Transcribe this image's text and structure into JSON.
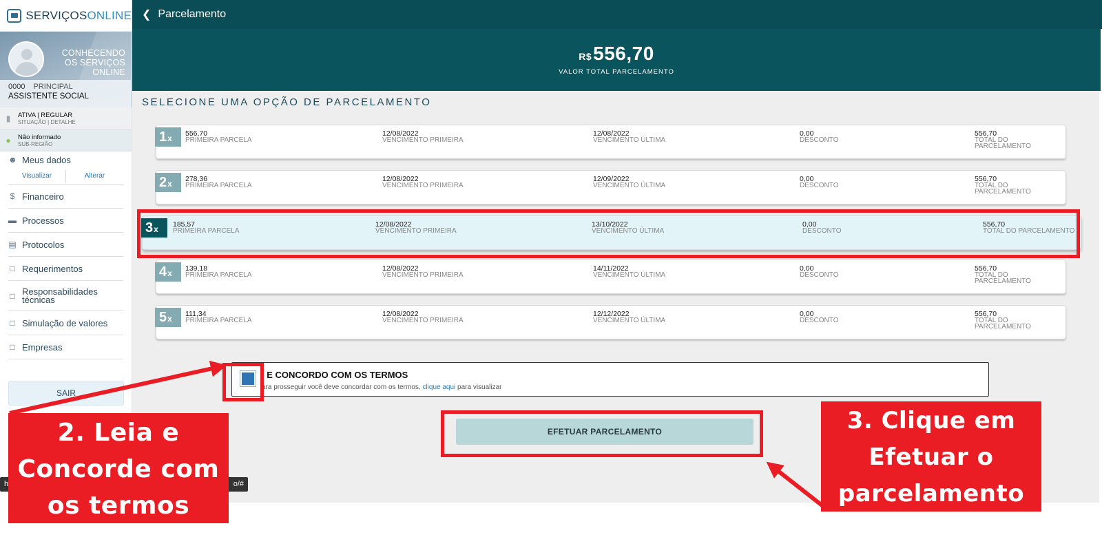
{
  "brand": {
    "part1": "SERVIÇOS",
    "part2": "ONLINE"
  },
  "profile": {
    "name": "CONHECENDO OS SERVIÇOS ONLINE",
    "registration": "0000",
    "registration_type": "PRINCIPAL",
    "role": "ASSISTENTE SOCIAL"
  },
  "status": {
    "value": "ATIVA | REGULAR",
    "label": "SITUAÇÃO | DETALHE"
  },
  "region": {
    "value": "Não informado",
    "label": "SUB-REGIÃO"
  },
  "menu": {
    "meus_dados": "Meus dados",
    "visualizar": "Visualizar",
    "alterar": "Alterar",
    "items": [
      {
        "label": "Financeiro",
        "icon": "dollar-icon"
      },
      {
        "label": "Processos",
        "icon": "folder-icon"
      },
      {
        "label": "Protocolos",
        "icon": "document-icon"
      },
      {
        "label": "Requerimentos",
        "icon": "clipboard-icon"
      },
      {
        "label": "Responsabilidades técnicas",
        "icon": "clipboard-icon"
      },
      {
        "label": "Simulação de valores",
        "icon": "clipboard-icon"
      },
      {
        "label": "Empresas",
        "icon": "clipboard-icon"
      }
    ],
    "logout": "SAIR"
  },
  "header": {
    "back_icon": "chevron-left-icon",
    "title": "Parcelamento"
  },
  "summary": {
    "currency": "R$",
    "total": "556,70",
    "caption": "VALOR TOTAL PARCELAMENTO"
  },
  "section_title": "SELECIONE UMA OPÇÃO DE PARCELAMENTO",
  "column_labels": {
    "first": "PRIMEIRA PARCELA",
    "due_first": "VENCIMENTO PRIMEIRA",
    "due_last": "VENCIMENTO ÚLTIMA",
    "discount": "DESCONTO",
    "total": "TOTAL DO PARCELAMENTO"
  },
  "options": [
    {
      "n": "1",
      "x": "x",
      "first": "556,70",
      "due_first": "12/08/2022",
      "due_last": "12/08/2022",
      "discount": "0,00",
      "total": "556,70",
      "selected": false
    },
    {
      "n": "2",
      "x": "x",
      "first": "278,36",
      "due_first": "12/08/2022",
      "due_last": "12/09/2022",
      "discount": "0,00",
      "total": "556,70",
      "selected": false
    },
    {
      "n": "3",
      "x": "x",
      "first": "185,57",
      "due_first": "12/08/2022",
      "due_last": "13/10/2022",
      "discount": "0,00",
      "total": "556,70",
      "selected": true
    },
    {
      "n": "4",
      "x": "x",
      "first": "139,18",
      "due_first": "12/08/2022",
      "due_last": "14/11/2022",
      "discount": "0,00",
      "total": "556,70",
      "selected": false
    },
    {
      "n": "5",
      "x": "x",
      "first": "111,34",
      "due_first": "12/08/2022",
      "due_last": "12/12/2022",
      "discount": "0,00",
      "total": "556,70",
      "selected": false
    }
  ],
  "terms": {
    "title": "I E CONCORDO COM OS TERMOS",
    "text_before": "ara prosseguir você deve concordar com os termos, ",
    "link": "clique aqui",
    "text_after": " para visualizar",
    "checked": true
  },
  "submit_button": "EFETUAR PARCELAMENTO",
  "status_bar": {
    "left": "h",
    "right": "o/#"
  },
  "annotations": {
    "left": "2. Leia e Concorde com os termos",
    "right": "3. Clique em Efetuar o parcelamento",
    "color": "#ea1c24"
  },
  "colors": {
    "header": "#0a4d57",
    "hero": "#0a545e",
    "accent": "#2f74b5",
    "selected_row": "#e3f4f8"
  }
}
